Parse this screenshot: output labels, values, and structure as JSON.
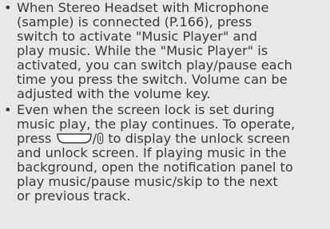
{
  "bullets": [
    {
      "marker": "•",
      "lines": [
        "When Stereo Headset with Microphone",
        "(sample) is connected (P.166), press",
        "switch to activate \"Music Player\" and",
        "play music. While the \"Music Player\" is",
        "activated, you can switch play/pause each",
        "time you press the switch. Volume can be",
        "adjusted with the volume key."
      ]
    },
    {
      "marker": "•",
      "lines": [
        "Even when the screen lock is set during",
        "music play, the play continues. To operate,"
      ],
      "key_line": {
        "prefix": "press",
        "separator": "/",
        "suffix": "to display the unlock screen"
      },
      "lines_after": [
        "and unlock screen. If playing music in the",
        "background, open the notification panel to",
        "play music/pause music/skip to the next",
        "or previous track."
      ]
    }
  ],
  "icons": {
    "wide_key": "wide-rounded-key-icon",
    "power_key": "power-key-icon"
  }
}
